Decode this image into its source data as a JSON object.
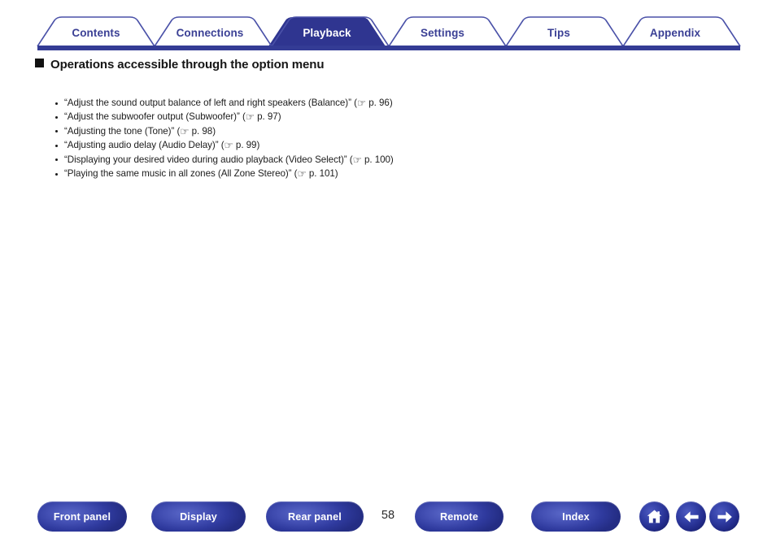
{
  "tabs": [
    {
      "label": "Contents",
      "active": false
    },
    {
      "label": "Connections",
      "active": false
    },
    {
      "label": "Playback",
      "active": true
    },
    {
      "label": "Settings",
      "active": false
    },
    {
      "label": "Tips",
      "active": false
    },
    {
      "label": "Appendix",
      "active": false
    }
  ],
  "section": {
    "bullet_marker": "filled-square",
    "heading": "Operations accessible through the option menu"
  },
  "links": [
    {
      "text_before": "“Adjust the sound output balance of left and right speakers (Balance)” (",
      "pointer_icon": "☞",
      "page_ref": "p. 96",
      "text_after": ")"
    },
    {
      "text_before": "“Adjust the subwoofer output (Subwoofer)” (",
      "pointer_icon": "☞",
      "page_ref": "p. 97",
      "text_after": ")"
    },
    {
      "text_before": "“Adjusting the tone (Tone)” (",
      "pointer_icon": "☞",
      "page_ref": "p. 98",
      "text_after": ")"
    },
    {
      "text_before": "“Adjusting audio delay (Audio Delay)” (",
      "pointer_icon": "☞",
      "page_ref": "p. 99",
      "text_after": ")"
    },
    {
      "text_before": "“Displaying your desired video during audio playback (Video Select)” (",
      "pointer_icon": "☞",
      "page_ref": "p. 100",
      "text_after": ")"
    },
    {
      "text_before": "“Playing the same music in all zones (All Zone Stereo)” (",
      "pointer_icon": "☞",
      "page_ref": "p. 101",
      "text_after": ")"
    }
  ],
  "footer": {
    "buttons": [
      {
        "label": "Front panel"
      },
      {
        "label": "Display"
      },
      {
        "label": "Rear panel"
      },
      {
        "label": "Remote"
      },
      {
        "label": "Index"
      }
    ],
    "page_number": "58",
    "icon_buttons": [
      {
        "name": "home-icon",
        "glyph": "house"
      },
      {
        "name": "back-arrow-icon",
        "glyph": "arrow-left"
      },
      {
        "name": "forward-arrow-icon",
        "glyph": "arrow-right"
      }
    ]
  },
  "colors": {
    "brand_blue": "#3b4095",
    "active_tab_fill": "#2f3590",
    "button_blue": "#2a3390",
    "text_black": "#1c1c1c",
    "page_background": "#ffffff"
  }
}
